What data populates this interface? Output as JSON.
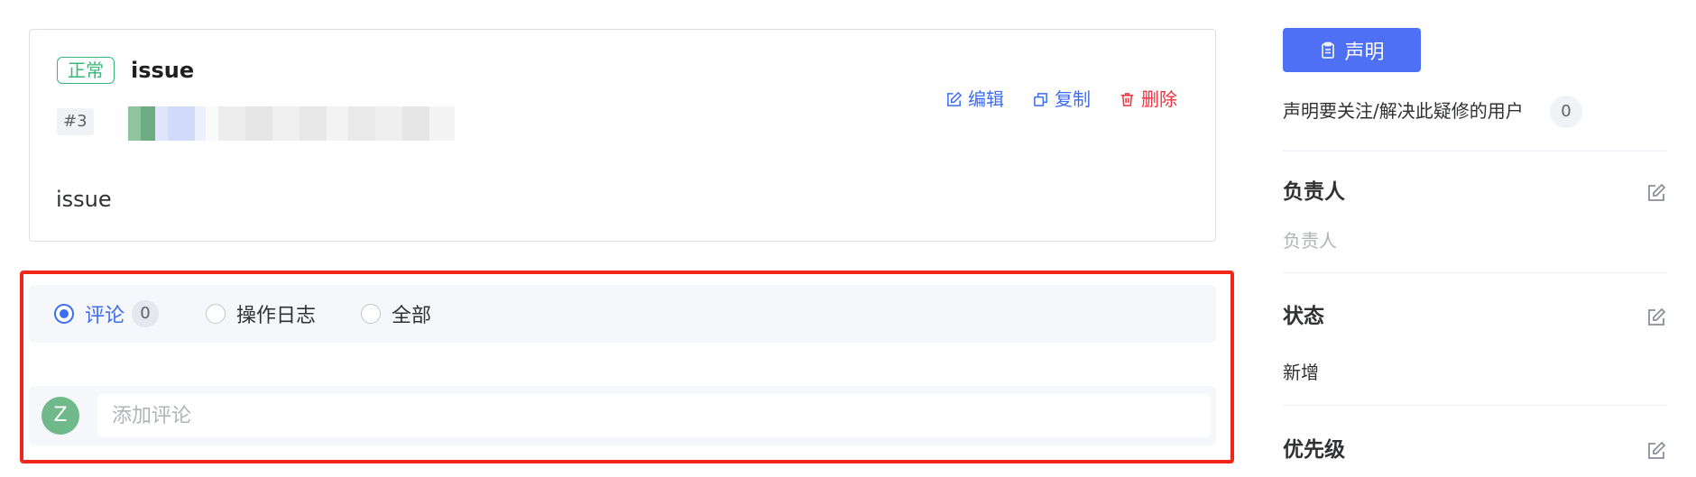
{
  "issue": {
    "status_tag": "正常",
    "title": "issue",
    "number": "#3",
    "body": "issue",
    "actions": {
      "edit": "编辑",
      "copy": "复制",
      "delete": "删除"
    }
  },
  "activity": {
    "tabs": [
      {
        "label": "评论",
        "count": "0",
        "selected": true
      },
      {
        "label": "操作日志"
      },
      {
        "label": "全部"
      }
    ],
    "avatar_initial": "Z",
    "comment_placeholder": "添加评论"
  },
  "sidebar": {
    "claim_button": "声明",
    "claim_desc": "声明要关注/解决此疑修的用户",
    "claim_count": "0",
    "sections": [
      {
        "title": "负责人",
        "value": "负责人",
        "is_placeholder": true
      },
      {
        "title": "状态",
        "value": "新增"
      },
      {
        "title": "优先级"
      }
    ]
  },
  "colors": {
    "primary": "#3d6df2",
    "primary_button": "#4d70f5",
    "danger": "#f5303b",
    "success_tag": "#35b87a",
    "highlight_border": "#f2271c",
    "avatar": "#6fb98a"
  },
  "icons": [
    "edit-icon",
    "copy-icon",
    "trash-icon",
    "clipboard-icon"
  ]
}
